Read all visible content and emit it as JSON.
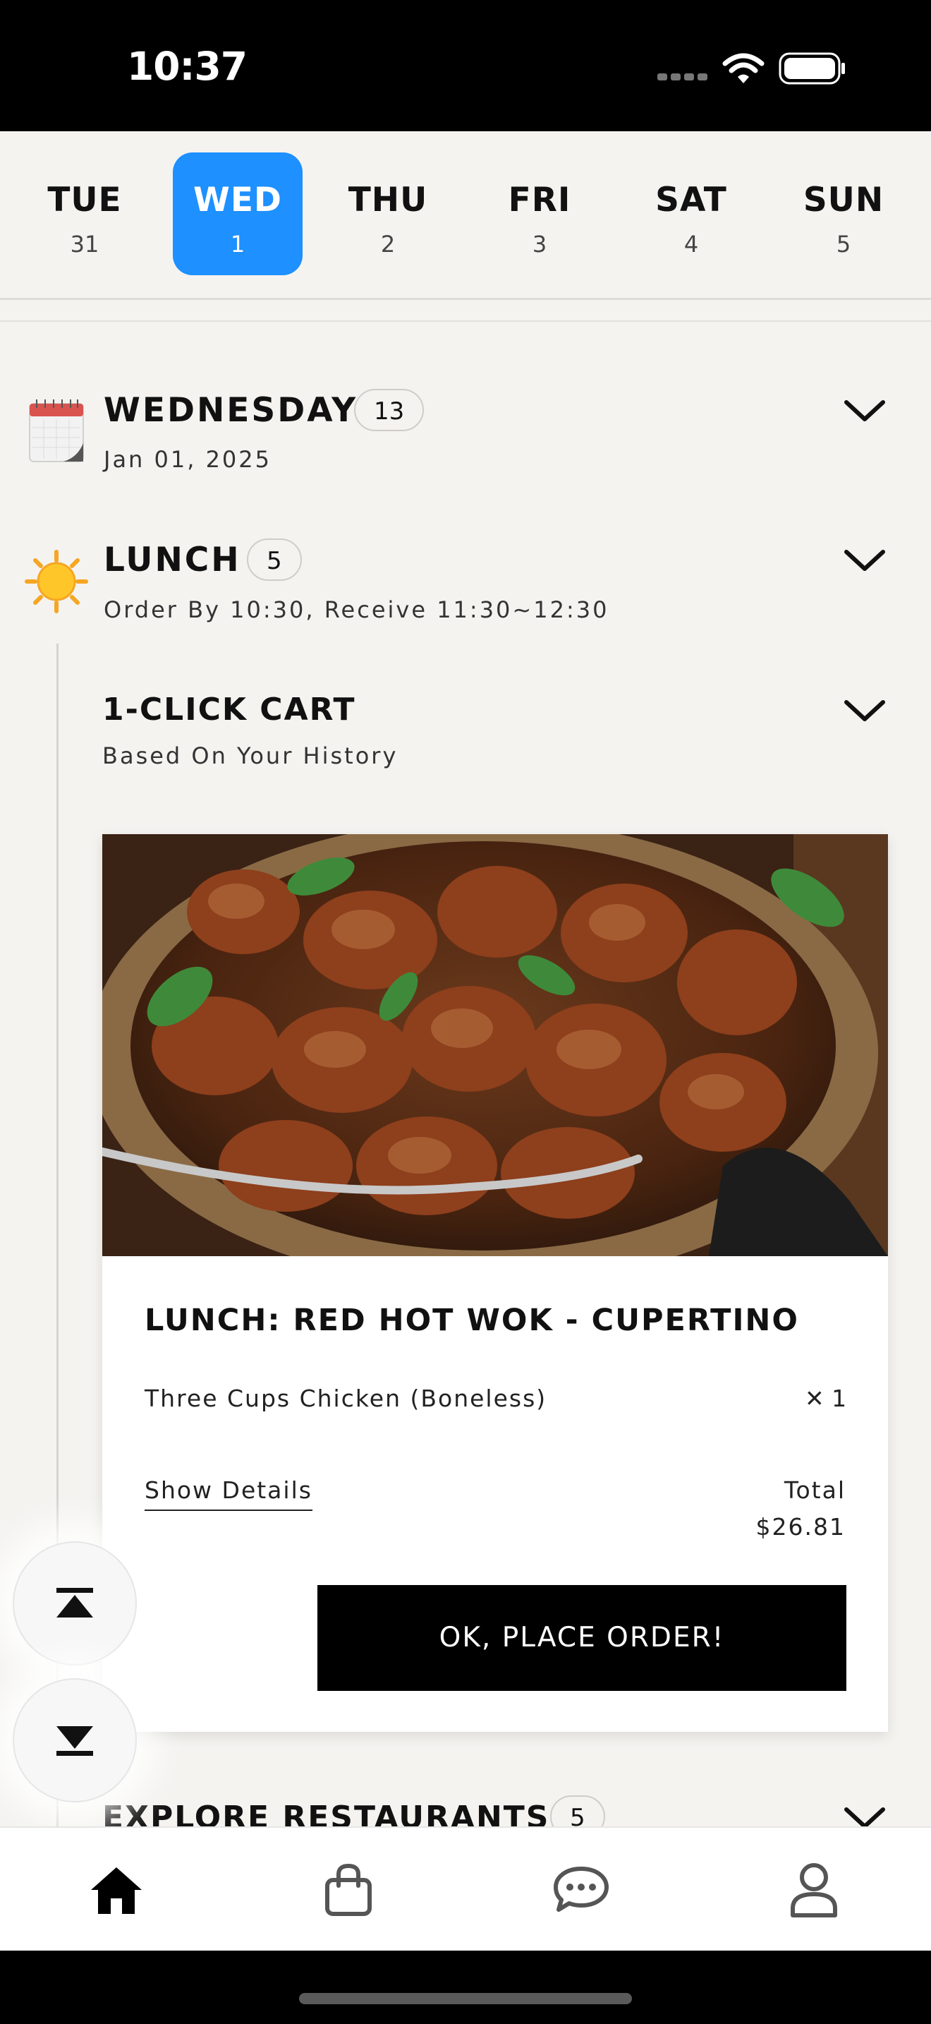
{
  "status_bar": {
    "time": "10:37"
  },
  "day_strip": {
    "days": [
      {
        "name": "TUE",
        "num": "31"
      },
      {
        "name": "WED",
        "num": "1"
      },
      {
        "name": "THU",
        "num": "2"
      },
      {
        "name": "FRI",
        "num": "3"
      },
      {
        "name": "SAT",
        "num": "4"
      },
      {
        "name": "SUN",
        "num": "5"
      }
    ],
    "selected": "WED"
  },
  "day_section": {
    "title": "WEDNESDAY",
    "count": "13",
    "date": "Jan 01, 2025",
    "icon": "calendar-icon"
  },
  "meal_section": {
    "title": "LUNCH",
    "count": "5",
    "subtitle": "Order By 10:30, Receive 11:30~12:30",
    "icon": "sun-icon"
  },
  "cart_section": {
    "title": "1-CLICK CART",
    "subtitle": "Based On Your History"
  },
  "order_card": {
    "title": "LUNCH: RED HOT WOK - CUPERTINO",
    "item_name": "Three Cups Chicken (Boneless)",
    "item_qty": "✕ 1",
    "show_details": "Show Details",
    "total_label": "Total",
    "total_value": "$26.81",
    "place_order": "OK, PLACE ORDER!"
  },
  "explore_section": {
    "title": "EXPLORE RESTAURANTS",
    "count": "5"
  },
  "tab_bar": {
    "tabs": [
      "home-icon",
      "bag-icon",
      "chat-icon",
      "profile-icon"
    ],
    "active": "home-icon"
  },
  "colors": {
    "accent": "#1e90ff",
    "background": "#f4f3f0",
    "button": "#000000"
  }
}
